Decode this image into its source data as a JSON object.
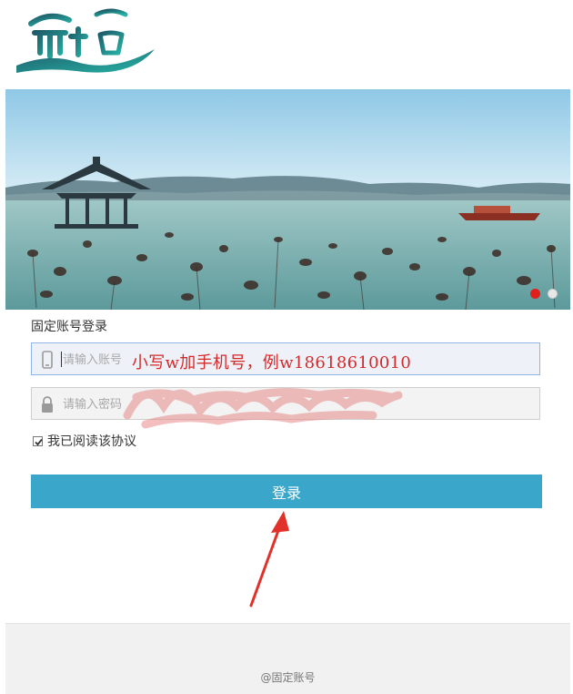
{
  "logo": {
    "icon": "city-logo-icon"
  },
  "banner": {
    "icon": "west-lake-photo",
    "carousel_count": 2,
    "carousel_active_index": 0
  },
  "login": {
    "title": "固定账号登录",
    "account_placeholder": "请输入账号",
    "password_placeholder": "请输入密码",
    "account_icon": "phone-icon",
    "password_icon": "lock-icon",
    "agree_label": "我已阅读该协议",
    "agree_checked": true,
    "submit_label": "登录"
  },
  "annotation": {
    "text": "小写w加手机号，例w18618610010",
    "color": "#d42a2a"
  },
  "footer": {
    "text": "@固定账号"
  },
  "colors": {
    "accent": "#3aa6c9",
    "annotation": "#d42a2a"
  }
}
